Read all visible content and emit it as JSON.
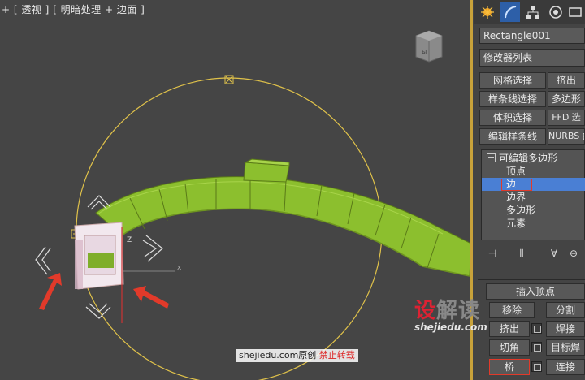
{
  "viewport": {
    "label": "+ [ 透视 ] [ 明暗处理 + 边面 ]"
  },
  "command_panel": {
    "tabs": [
      "create-icon",
      "modify-icon",
      "hierarchy-icon",
      "motion-icon",
      "display-icon"
    ],
    "object_name": "Rectangle001",
    "modifier_list": "修改器列表",
    "modifier_buttons": [
      "网格选择",
      "挤出",
      "样条线选择",
      "多边形",
      "体积选择",
      "FFD 选",
      "编辑样条线",
      "NURBS 曲"
    ],
    "stack": {
      "root": "可编辑多边形",
      "items": [
        "顶点",
        "边",
        "边界",
        "多边形",
        "元素"
      ],
      "selected": "边"
    },
    "edit_edges": {
      "header": "插入顶点",
      "buttons": [
        "移除",
        "分割",
        "挤出",
        "焊接",
        "切角",
        "目标焊",
        "桥",
        "连接"
      ]
    }
  },
  "watermark": {
    "logo_part1": "设",
    "logo_part2": "解读",
    "url": "shejiedu.com",
    "bar_text": "shejiedu.com原创",
    "bar_warning": "禁止转载"
  },
  "colors": {
    "viewport_bg": "#454545",
    "panel_bg": "#444444",
    "selection": "#4a7fd4",
    "object_green": "#8cbf2e",
    "circle": "#e0c24a",
    "arrow": "#e23a2a",
    "highlight_box": "#e23a2a"
  }
}
